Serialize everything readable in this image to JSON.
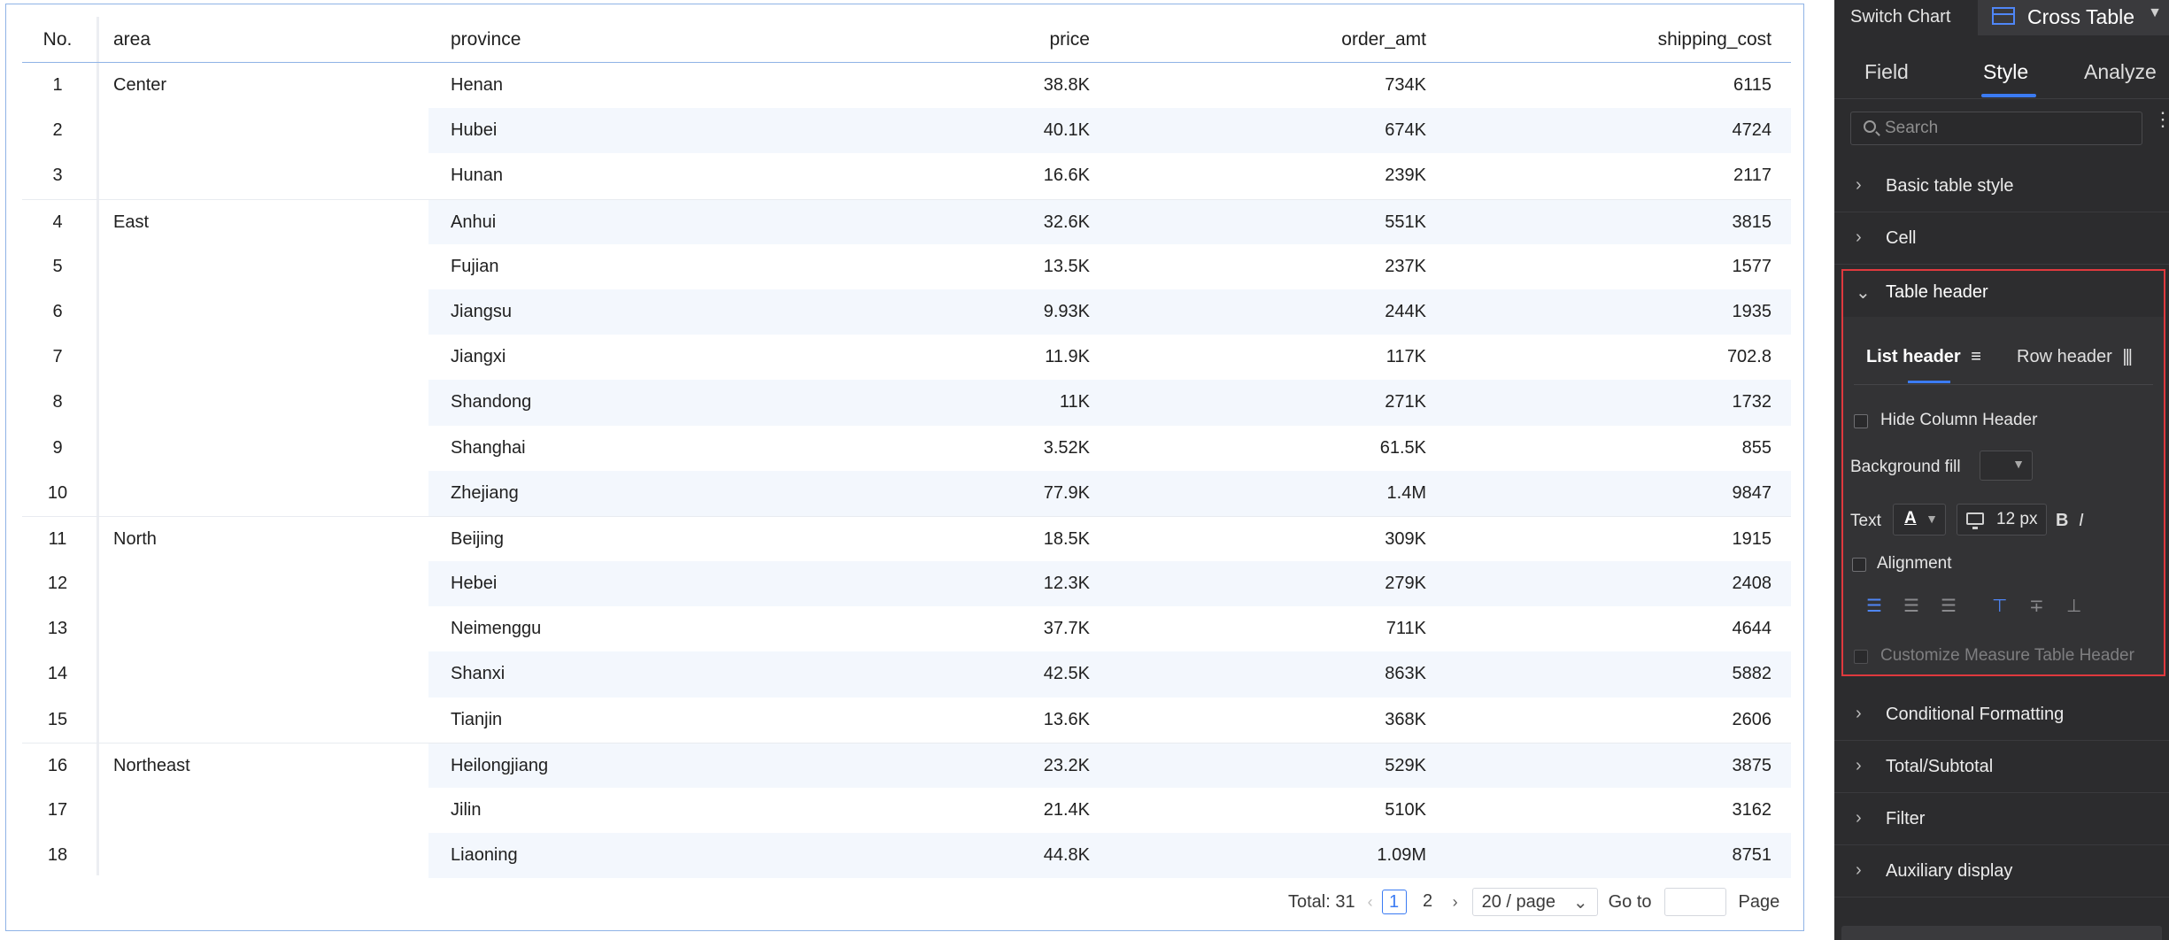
{
  "table": {
    "headers": {
      "no": "No.",
      "area": "area",
      "province": "province",
      "price": "price",
      "order_amt": "order_amt",
      "shipping_cost": "shipping_cost"
    },
    "rows": [
      {
        "no": "1",
        "area": "Center",
        "province": "Henan",
        "price": "38.8K",
        "order_amt": "734K",
        "shipping_cost": "6115"
      },
      {
        "no": "2",
        "area": "",
        "province": "Hubei",
        "price": "40.1K",
        "order_amt": "674K",
        "shipping_cost": "4724"
      },
      {
        "no": "3",
        "area": "",
        "province": "Hunan",
        "price": "16.6K",
        "order_amt": "239K",
        "shipping_cost": "2117"
      },
      {
        "no": "4",
        "area": "East",
        "province": "Anhui",
        "price": "32.6K",
        "order_amt": "551K",
        "shipping_cost": "3815"
      },
      {
        "no": "5",
        "area": "",
        "province": "Fujian",
        "price": "13.5K",
        "order_amt": "237K",
        "shipping_cost": "1577"
      },
      {
        "no": "6",
        "area": "",
        "province": "Jiangsu",
        "price": "9.93K",
        "order_amt": "244K",
        "shipping_cost": "1935"
      },
      {
        "no": "7",
        "area": "",
        "province": "Jiangxi",
        "price": "11.9K",
        "order_amt": "117K",
        "shipping_cost": "702.8"
      },
      {
        "no": "8",
        "area": "",
        "province": "Shandong",
        "price": "11K",
        "order_amt": "271K",
        "shipping_cost": "1732"
      },
      {
        "no": "9",
        "area": "",
        "province": "Shanghai",
        "price": "3.52K",
        "order_amt": "61.5K",
        "shipping_cost": "855"
      },
      {
        "no": "10",
        "area": "",
        "province": "Zhejiang",
        "price": "77.9K",
        "order_amt": "1.4M",
        "shipping_cost": "9847"
      },
      {
        "no": "11",
        "area": "North",
        "province": "Beijing",
        "price": "18.5K",
        "order_amt": "309K",
        "shipping_cost": "1915"
      },
      {
        "no": "12",
        "area": "",
        "province": "Hebei",
        "price": "12.3K",
        "order_amt": "279K",
        "shipping_cost": "2408"
      },
      {
        "no": "13",
        "area": "",
        "province": "Neimenggu",
        "price": "37.7K",
        "order_amt": "711K",
        "shipping_cost": "4644"
      },
      {
        "no": "14",
        "area": "",
        "province": "Shanxi",
        "price": "42.5K",
        "order_amt": "863K",
        "shipping_cost": "5882"
      },
      {
        "no": "15",
        "area": "",
        "province": "Tianjin",
        "price": "13.6K",
        "order_amt": "368K",
        "shipping_cost": "2606"
      },
      {
        "no": "16",
        "area": "Northeast",
        "province": "Heilongjiang",
        "price": "23.2K",
        "order_amt": "529K",
        "shipping_cost": "3875"
      },
      {
        "no": "17",
        "area": "",
        "province": "Jilin",
        "price": "21.4K",
        "order_amt": "510K",
        "shipping_cost": "3162"
      },
      {
        "no": "18",
        "area": "",
        "province": "Liaoning",
        "price": "44.8K",
        "order_amt": "1.09M",
        "shipping_cost": "8751"
      }
    ]
  },
  "pagination": {
    "total_label": "Total: 31",
    "pages": [
      "1",
      "2"
    ],
    "current_page": "1",
    "page_size": "20 / page",
    "goto_label": "Go to",
    "page_label": "Page",
    "goto_value": ""
  },
  "panel": {
    "switch_chart_label": "Switch Chart",
    "chart_type": "Cross Table",
    "tabs": [
      "Field",
      "Style",
      "Analyze"
    ],
    "active_tab": "Style",
    "search_placeholder": "Search",
    "sections_top": [
      "Basic table style",
      "Cell"
    ],
    "expanded_section": {
      "title": "Table header",
      "subtabs": [
        "List header",
        "Row header"
      ],
      "active_subtab": "List header",
      "hide_column_header": "Hide Column Header",
      "background_fill": "Background fill",
      "text_label": "Text",
      "text_color_glyph": "A",
      "font_size": "12 px",
      "bold_glyph": "B",
      "italic_glyph": "I",
      "alignment": "Alignment",
      "customize_measure": "Customize Measure Table Header",
      "highlight_color": "#e0393e"
    },
    "sections_bottom": [
      "Conditional Formatting",
      "Total/Subtotal",
      "Filter",
      "Auxiliary display"
    ]
  },
  "colors": {
    "accent": "#3b7bf3",
    "row_alt": "#f3f7fd",
    "panel_bg": "#2c2c2e"
  },
  "icons": [
    "cross-table-icon",
    "search-icon",
    "chevron-right-icon",
    "chevron-down-icon",
    "more-icon",
    "list-header-icon",
    "row-header-icon",
    "monitor-icon",
    "align-left-icon",
    "align-center-icon",
    "align-right-icon",
    "align-top-icon",
    "align-middle-icon",
    "align-bottom-icon"
  ]
}
